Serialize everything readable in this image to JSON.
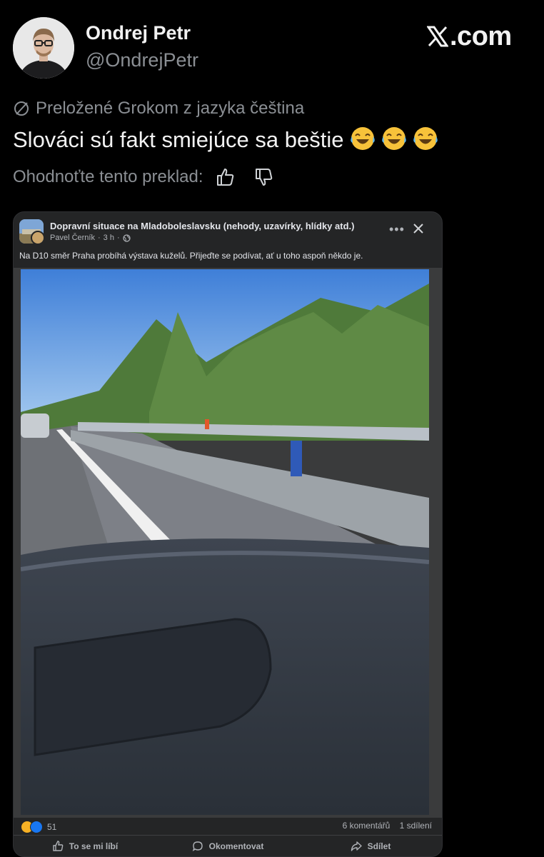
{
  "tweet": {
    "author_name": "Ondrej Petr",
    "handle": "@OndrejPetr",
    "site_logo": "𝕏",
    "site_domain": ".com",
    "translated_label": "Preložené Grokom z jazyka čeština",
    "text": "Slováci sú fakt smiejúce sa beštie",
    "emojis": [
      "face-with-tears-of-joy",
      "face-with-tears-of-joy",
      "face-with-tears-of-joy"
    ],
    "rate_label": "Ohodnoťte tento preklad:",
    "icons": {
      "translate": "translate-icon",
      "like": "thumbs-up-icon",
      "dislike": "thumbs-down-icon"
    }
  },
  "fb_post": {
    "group_name": "Dopravní situace na Mladoboleslavsku (nehody, uzavírky, hlídky atd.)",
    "author": "Pavel Černík",
    "time": "3 h",
    "separator": "·",
    "privacy_icon": "globe-icon",
    "more_label": "•••",
    "caption": "Na D10 směr Praha probíhá výstava kuželů. Přijeďte se podívat, ať u toho aspoň někdo je.",
    "photo_description_icon": "photo",
    "reaction_count": "51",
    "comments": "6 komentářů",
    "shares": "1 sdílení",
    "actions": {
      "like": "To se mi líbí",
      "comment": "Okomentovat",
      "share": "Sdílet"
    }
  },
  "colors": {
    "background": "#000000",
    "fb_card": "#242526",
    "muted_text": "#8b8f94",
    "fb_like_blue": "#1877f2",
    "fb_haha_yellow": "#f7b125"
  }
}
